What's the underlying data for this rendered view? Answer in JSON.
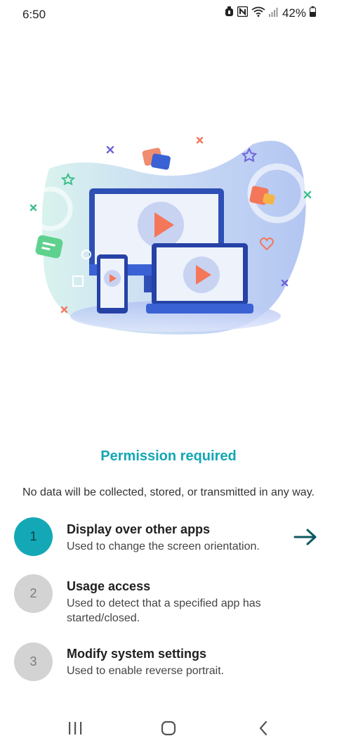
{
  "status_bar": {
    "time": "6:50",
    "battery_percent": "42%",
    "icons": [
      "alarm-icon",
      "nfc-icon",
      "wifi-icon",
      "signal-icon",
      "battery-icon"
    ]
  },
  "illustration": {
    "description_icons": [
      "monitor-icon",
      "laptop-icon",
      "phone-icon",
      "play-icon",
      "chat-bubble-icon",
      "heart-icon",
      "star-icon"
    ]
  },
  "title": "Permission required",
  "subtitle": "No data will be collected, stored, or transmitted in any way.",
  "steps": [
    {
      "number": "1",
      "title": "Display over other apps",
      "description": "Used to change the screen orientation.",
      "active": true
    },
    {
      "number": "2",
      "title": "Usage access",
      "description": "Used to detect that a specified app has started/closed.",
      "active": false
    },
    {
      "number": "3",
      "title": "Modify system settings",
      "description": "Used to enable reverse portrait.",
      "active": false
    }
  ],
  "colors": {
    "accent": "#14a8b6",
    "title": "#12a7b5",
    "inactive_circle": "#d3d3d3",
    "arrow": "#0e5961"
  },
  "navbar": {
    "icons": [
      "recent-apps-icon",
      "home-icon",
      "back-icon"
    ]
  }
}
